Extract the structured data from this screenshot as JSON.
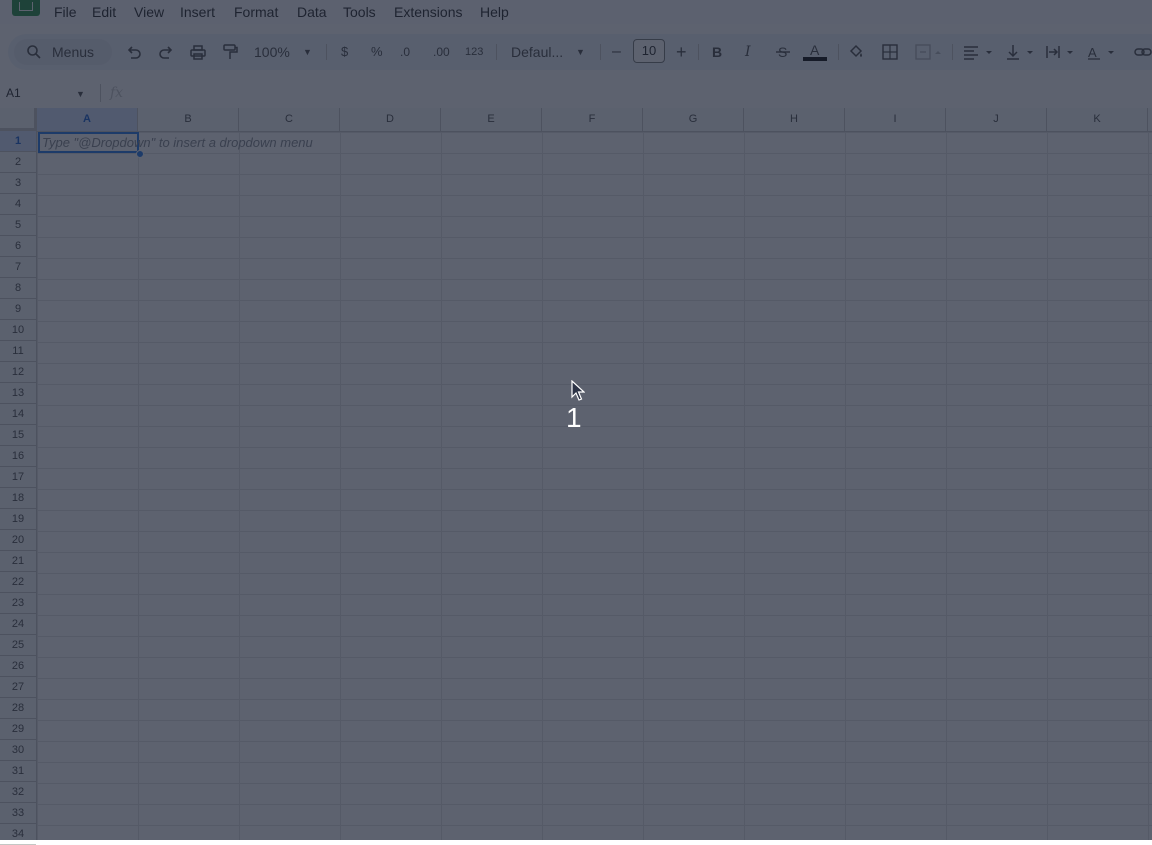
{
  "menu": [
    "File",
    "Edit",
    "View",
    "Insert",
    "Format",
    "Data",
    "Tools",
    "Extensions",
    "Help"
  ],
  "toolbar": {
    "search_label": "Menus",
    "zoom": "100%",
    "currency": "$",
    "percent": "%",
    "dec_decrease": ".0",
    "dec_increase": ".00",
    "number_format": "123",
    "font": "Defaul...",
    "minus": "–",
    "font_size": "10",
    "plus": "+",
    "bold": "B",
    "italic": "I",
    "text_color": "A"
  },
  "formula_bar": {
    "cell_ref": "A1",
    "fx": "fx"
  },
  "columns": [
    "A",
    "B",
    "C",
    "D",
    "E",
    "F",
    "G",
    "H",
    "I",
    "J",
    "K"
  ],
  "rows": [
    "1",
    "2",
    "3",
    "4",
    "5",
    "6",
    "7",
    "8",
    "9",
    "10",
    "11",
    "12",
    "13",
    "14",
    "15",
    "16",
    "17",
    "18",
    "19",
    "20",
    "21",
    "22",
    "23",
    "24",
    "25",
    "26",
    "27",
    "28",
    "29",
    "30",
    "31",
    "32",
    "33",
    "34"
  ],
  "selected": {
    "column": "A",
    "row": "1"
  },
  "cell_hint": "Type \"@Dropdown\"  to insert a dropdown menu",
  "step_number": "1",
  "colors": {
    "accent": "#1a73e8",
    "overlay": "#1f2638",
    "brand": "#1e8e3e"
  }
}
